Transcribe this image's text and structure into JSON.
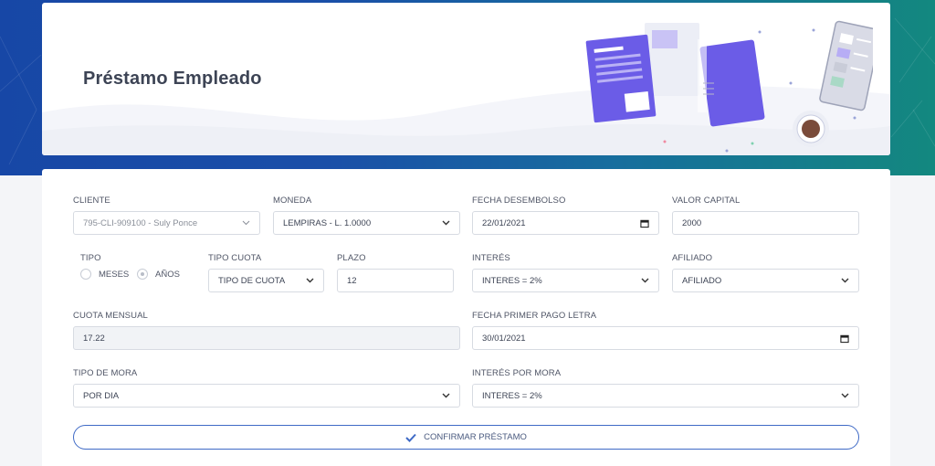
{
  "page": {
    "title": "Préstamo Empleado"
  },
  "form": {
    "cliente": {
      "label": "CLIENTE",
      "value": "795-CLI-909100 - Suly Ponce"
    },
    "moneda": {
      "label": "MONEDA",
      "value": "LEMPIRAS - L. 1.0000"
    },
    "fecha_desembolso": {
      "label": "FECHA DESEMBOLSO",
      "value": "22/01/2021"
    },
    "valor_capital": {
      "label": "VALOR CAPITAL",
      "value": "2000"
    },
    "tipo": {
      "label": "TIPO",
      "options": [
        "MESES",
        "AÑOS"
      ],
      "selected": "AÑOS"
    },
    "tipo_cuota": {
      "label": "TIPO CUOTA",
      "value": "TIPO DE CUOTA"
    },
    "plazo": {
      "label": "PLAZO",
      "value": "12"
    },
    "interes": {
      "label": "INTERÉS",
      "value": "INTERES = 2%"
    },
    "afiliado": {
      "label": "AFILIADO",
      "value": "AFILIADO"
    },
    "cuota_mensual": {
      "label": "CUOTA MENSUAL",
      "value": "17.22"
    },
    "fecha_primer_pago": {
      "label": "FECHA PRIMER PAGO LETRA",
      "value": "30/01/2021"
    },
    "tipo_mora": {
      "label": "TIPO DE MORA",
      "value": "POR DIA"
    },
    "interes_mora": {
      "label": "INTERÉS POR MORA",
      "value": "INTERES = 2%"
    },
    "confirm_label": "CONFIRMAR PRÉSTAMO"
  },
  "colors": {
    "band_left": "#1747a6",
    "band_right": "#13887f",
    "accent": "#3f6ac6",
    "illustration_purple": "#6b5ce7"
  },
  "icons": [
    "chevron-down-icon",
    "calendar-icon",
    "check-icon"
  ]
}
